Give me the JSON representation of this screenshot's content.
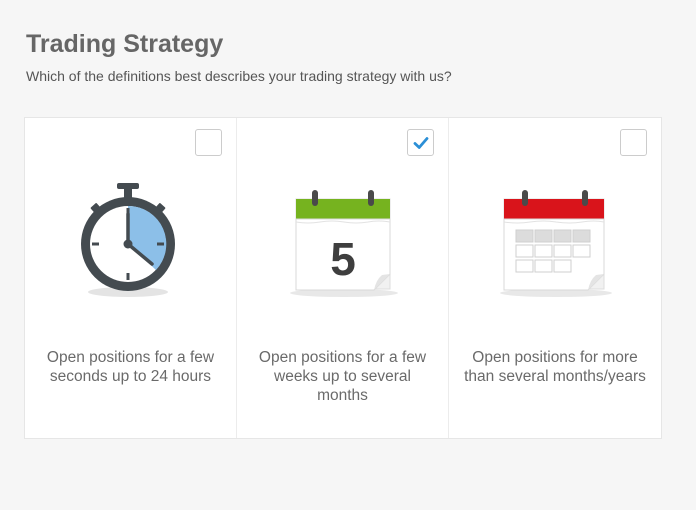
{
  "header": {
    "title": "Trading Strategy",
    "subtitle": "Which of the definitions best describes your trading strategy with us?"
  },
  "options": [
    {
      "label": "Open positions for a few\nseconds up to 24 hours",
      "icon": "stopwatch-icon",
      "checked": false
    },
    {
      "label": "Open positions for a few\nweeks up to several\nmonths",
      "icon": "calendar-day-icon",
      "calendar_number": "5",
      "checked": true
    },
    {
      "label": "Open positions for more\nthan several months/years",
      "icon": "calendar-grid-icon",
      "checked": false
    }
  ],
  "colors": {
    "check_mark": "#2b8fd6",
    "stopwatch_fill": "#8cbfe8",
    "calendar_green": "#76b31f",
    "calendar_red": "#d9141b"
  }
}
